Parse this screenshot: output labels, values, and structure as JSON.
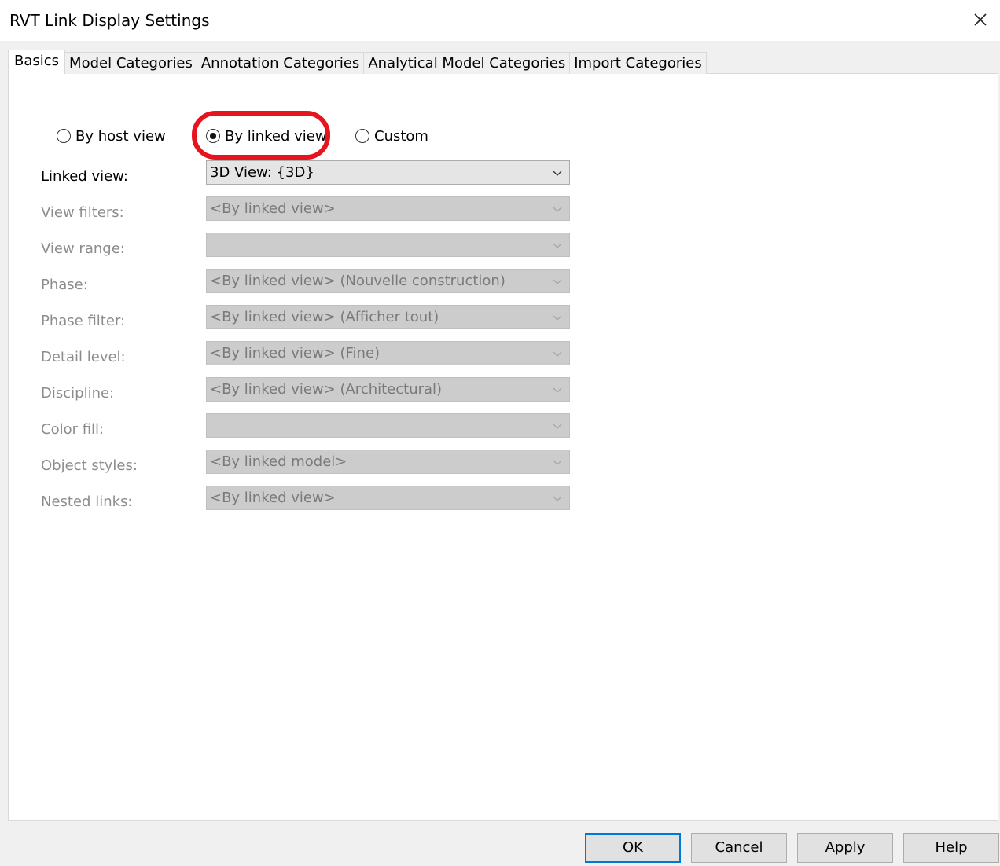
{
  "window": {
    "title": "RVT Link Display Settings"
  },
  "tabs": [
    {
      "label": "Basics",
      "active": true
    },
    {
      "label": "Model Categories",
      "active": false
    },
    {
      "label": "Annotation Categories",
      "active": false
    },
    {
      "label": "Analytical Model Categories",
      "active": false
    },
    {
      "label": "Import Categories",
      "active": false
    }
  ],
  "display_mode": {
    "options": [
      {
        "label": "By host view",
        "checked": false
      },
      {
        "label": "By linked view",
        "checked": true
      },
      {
        "label": "Custom",
        "checked": false
      }
    ],
    "highlight_color": "#e5141f"
  },
  "fields": [
    {
      "label": "Linked view:",
      "value": "3D View: {3D}",
      "enabled": true
    },
    {
      "label": "View filters:",
      "value": "<By linked view>",
      "enabled": false
    },
    {
      "label": "View range:",
      "value": "",
      "enabled": false
    },
    {
      "label": "Phase:",
      "value": "<By linked view> (Nouvelle construction)",
      "enabled": false
    },
    {
      "label": "Phase filter:",
      "value": "<By linked view> (Afficher tout)",
      "enabled": false
    },
    {
      "label": "Detail level:",
      "value": "<By linked view> (Fine)",
      "enabled": false
    },
    {
      "label": "Discipline:",
      "value": "<By linked view> (Architectural)",
      "enabled": false
    },
    {
      "label": "Color fill:",
      "value": "",
      "enabled": false
    },
    {
      "label": "Object styles:",
      "value": "<By linked model>",
      "enabled": false
    },
    {
      "label": "Nested links:",
      "value": "<By linked view>",
      "enabled": false
    }
  ],
  "buttons": {
    "ok": "OK",
    "cancel": "Cancel",
    "apply": "Apply",
    "help": "Help"
  },
  "colors": {
    "default_button_border": "#0078d7"
  }
}
